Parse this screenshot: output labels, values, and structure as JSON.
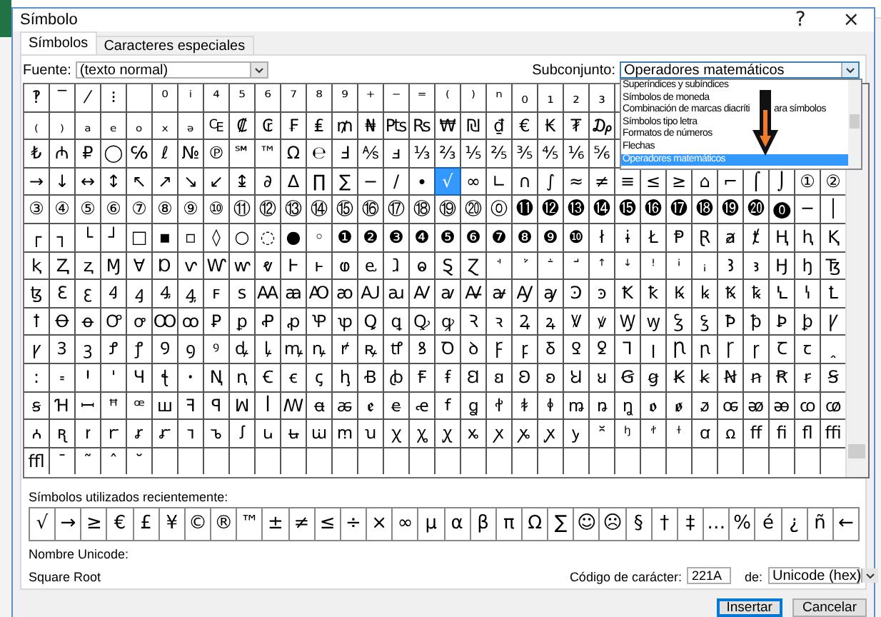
{
  "window": {
    "title": "Símbolo",
    "help": "?",
    "close": "×"
  },
  "tabs": [
    {
      "label": "Símbolos",
      "selected": true
    },
    {
      "label": "Caracteres especiales",
      "selected": false
    }
  ],
  "font": {
    "label": "Fuente:",
    "value": "(texto normal)"
  },
  "subset": {
    "label": "Subconjunto:",
    "value": "Operadores matemáticos",
    "expanded": true,
    "options": [
      {
        "label": "Superíndices y subíndices",
        "selected": false
      },
      {
        "label": "Símbolos de moneda",
        "selected": false
      },
      {
        "parts": [
          "Combinación de marcas diacríti",
          "ara símbolos"
        ],
        "selected": false
      },
      {
        "label": "Símbolos tipo letra",
        "selected": false
      },
      {
        "label": "Formatos de números",
        "selected": false
      },
      {
        "label": "Flechas",
        "selected": false
      },
      {
        "label": "Operadores matemáticos",
        "selected": true
      }
    ]
  },
  "grid": {
    "rows": [
      [
        "‽",
        "‾",
        "⁄",
        "⁝",
        null,
        "⁰",
        "ⁱ",
        "⁴",
        "⁵",
        "⁶",
        "⁷",
        "⁸",
        "⁹",
        "⁺",
        "⁻",
        "⁼",
        "⁽",
        "⁾",
        "ⁿ",
        "₀",
        "₁",
        "₂",
        "₃"
      ],
      [
        "₍",
        "₎",
        "ₐ",
        "ₑ",
        "ₒ",
        "ₓ",
        "ₔ",
        "₠",
        "₡",
        "₢",
        "₣",
        "₤",
        "₥",
        "₦",
        "₧",
        "₨",
        "₩",
        "₪",
        "₫",
        "€",
        "₭",
        "₮",
        "₯"
      ],
      [
        "₺",
        "₼",
        "₽",
        "◯",
        "℅",
        "ℓ",
        "№",
        "℗",
        "℠",
        "™",
        "Ω",
        "℮",
        "Ⅎ",
        "⅍",
        "ⅎ",
        "⅓",
        "⅔",
        "⅕",
        "⅖",
        "⅗",
        "⅘",
        "⅙",
        "⅚"
      ],
      [
        "→",
        "↓",
        "↔",
        "↕",
        "↖",
        "↗",
        "↘",
        "↙",
        "↨",
        "∂",
        "∆",
        "∏",
        "∑",
        "−",
        "∕",
        "∙",
        {
          "char": "√",
          "selected": true
        },
        "∞",
        "∟",
        "∩",
        "∫",
        "≈",
        "≠",
        "≡",
        "≤",
        "≥",
        "⌂",
        "⌐",
        "⌠",
        "⌡",
        "①",
        "②"
      ],
      [
        "③",
        "④",
        "⑤",
        "⑥",
        "⑦",
        "⑧",
        "⑨",
        "⑩",
        "⑪",
        "⑫",
        "⑬",
        "⑭",
        "⑮",
        "⑯",
        "⑰",
        "⑱",
        "⑲",
        "⑳",
        "⓪",
        "⓫",
        "⓬",
        "⓭",
        "⓮",
        "⓯",
        "⓰",
        "⓱",
        "⓲",
        "⓳",
        "⓴",
        "⓿",
        "─",
        "│"
      ],
      [
        "┌",
        "┐",
        "└",
        "┘",
        "□",
        "▪",
        "▫",
        "◊",
        "○",
        "◌",
        "●",
        "◦",
        "❶",
        "❷",
        "❸",
        "❹",
        "❺",
        "❻",
        "❼",
        "❽",
        "❾",
        "❿",
        "ł",
        "ɨ",
        "Ł",
        "Ᵽ",
        "Ɽ",
        "ⱥ",
        "ⱦ",
        "Ⱨ",
        "ⱨ",
        "Ⱪ"
      ],
      [
        "ⱪ",
        "Ⱬ",
        "ⱬ",
        "Ɱ",
        "Ɐ",
        "Ɒ",
        "ⱱ",
        "Ⱳ",
        "ⱳ",
        "ⱴ",
        "Ⱶ",
        "ⱶ",
        "ⱷ",
        "ⱸ",
        "ⱹ",
        "ⱺ",
        "Ȿ",
        "Ɀ",
        "ꜗ",
        "ꜘ",
        "ꜙ",
        "ꜚ",
        "ꜛ",
        "ꜜ",
        "ꜝ",
        "ꜞ",
        "ꜟ",
        "Ꜣ",
        "ꜣ",
        "Ꜧ",
        "ꜧ",
        "Ꜩ"
      ],
      [
        "ꜩ",
        "Ꜫ",
        "ꜫ",
        "Ꜭ",
        "ꜭ",
        "Ꜯ",
        "ꜯ",
        "ꜰ",
        "ꜱ",
        "Ꜳ",
        "ꜳ",
        "Ꜵ",
        "ꜵ",
        "Ꜷ",
        "ꜷ",
        "Ꜹ",
        "ꜹ",
        "Ꜻ",
        "ꜻ",
        "Ꜽ",
        "ꜽ",
        "Ꜿ",
        "ꜿ",
        "Ꝁ",
        "ꝁ",
        "Ꝃ",
        "ꝃ",
        "Ꝅ",
        "ꝅ",
        "Ꝇ",
        "ꝇ",
        "Ꝉ"
      ],
      [
        "ꝉ",
        "Ꝋ",
        "ꝋ",
        "Ꝍ",
        "ꝍ",
        "Ꝏ",
        "ꝏ",
        "Ꝑ",
        "ꝑ",
        "Ꝓ",
        "ꝓ",
        "Ꝕ",
        "ꝕ",
        "Ꝗ",
        "ꝗ",
        "Ꝙ",
        "ꝙ",
        "Ꝛ",
        "ꝛ",
        "Ꝝ",
        "ꝝ",
        "Ꝟ",
        "ꝟ",
        "Ꝡ",
        "ꝡ",
        "Ꝣ",
        "ꝣ",
        "Ꝥ",
        "ꝥ",
        "Ꝧ",
        "ꝧ",
        "Ꝩ"
      ],
      [
        "ꝩ",
        "Ꝫ",
        "ꝫ",
        "Ꝭ",
        "ꝭ",
        "Ꝯ",
        "ꝯ",
        "ꝰ",
        "ꝱ",
        "ꝲ",
        "ꝳ",
        "ꝴ",
        "ꝵ",
        "ꝶ",
        "ꝷ",
        "ꝸ",
        "Ꝺ",
        "ꝺ",
        "Ꝼ",
        "ꝼ",
        "Ᵹ",
        "Ꝿ",
        "ꝿ",
        "Ꞁ",
        "ꞁ",
        "Ꞃ",
        "ꞃ",
        "Ꞅ",
        "ꞅ",
        "Ꞇ",
        "ꞇ",
        "ꞈ"
      ],
      [
        "꞉",
        "꞊",
        "Ꞌ",
        "ꞌ",
        "Ɥ",
        "ꞎ",
        "ꞏ",
        "Ꞑ",
        "ꞑ",
        "Ꞓ",
        "ꞓ",
        "ꞔ",
        "ꞕ",
        "Ꞗ",
        "ꞗ",
        "Ꞙ",
        "ꞙ",
        "Ꞛ",
        "ꞛ",
        "Ꞝ",
        "ꞝ",
        "Ꞟ",
        "ꞟ",
        "Ꞡ",
        "ꞡ",
        "Ꞣ",
        "ꞣ",
        "Ꞥ",
        "ꞥ",
        "Ꞧ",
        "ꞧ",
        "Ꞩ"
      ],
      [
        "ꞩ",
        "Ɦ",
        "ꟷ",
        "ꟸ",
        "ꟹ",
        "ꟺ",
        "ꟻ",
        "ꟼ",
        "ꟽ",
        "ꟾ",
        "ꟿ",
        "ꬰ",
        "ꬱ",
        "ꬲ",
        "ꬳ",
        "ꬴ",
        "ꬵ",
        "ꬶ",
        "ꬷ",
        "ꬸ",
        "ꬹ",
        "ꬺ",
        "ꬻ",
        "ꬼ",
        "ꬽ",
        "ꬾ",
        "ꬿ",
        "ꭀ",
        "ꭁ",
        "ꭂ",
        "ꭃ",
        "ꭄ"
      ],
      [
        "ꭅ",
        "ꭆ",
        "ꭇ",
        "ꭈ",
        "ꭉ",
        "ꭊ",
        "ꭋ",
        "ꭌ",
        "ꭍ",
        "ꭎ",
        "ꭏ",
        "ꭐ",
        "ꭑ",
        "ꭒ",
        "ꭓ",
        "ꭔ",
        "ꭕ",
        "ꭖ",
        "ꭗ",
        "ꭘ",
        "ꭙ",
        "ꭚ",
        "꭛",
        "ꭜ",
        "ꭝ",
        "ꭞ",
        "ꭤ",
        "ꭥ",
        "ﬀ",
        "ﬁ",
        "ﬂ",
        "ﬃ"
      ],
      [
        "ﬄ",
        "ˉ",
        "˜",
        "ˆ",
        "˘"
      ]
    ]
  },
  "recent": {
    "label": "Símbolos utilizados recientemente:",
    "symbols": [
      "√",
      "→",
      "≥",
      "€",
      "£",
      "¥",
      "©",
      "®",
      "™",
      "±",
      "≠",
      "≤",
      "÷",
      "×",
      "∞",
      "µ",
      "α",
      "β",
      "π",
      "Ω",
      "∑",
      "☺",
      "☹",
      "§",
      "†",
      "‡",
      "…",
      "%",
      "é",
      "¿",
      "ñ",
      "←"
    ]
  },
  "unicode_name": {
    "label": "Nombre Unicode:",
    "value": "Square Root"
  },
  "char_code": {
    "label": "Código de carácter:",
    "value": "221A"
  },
  "code_from": {
    "label": "de:",
    "value": "Unicode (hex)"
  },
  "buttons": [
    {
      "label": "Insertar",
      "kind": "default"
    },
    {
      "label": "Cancelar",
      "kind": "normal"
    }
  ]
}
